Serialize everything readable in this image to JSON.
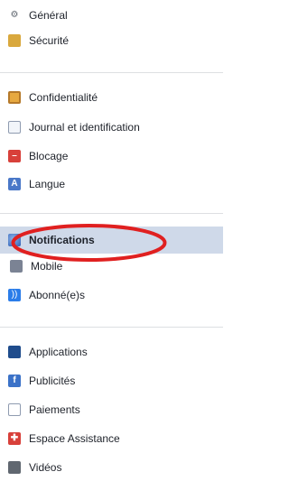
{
  "menu": {
    "items": [
      {
        "label": "Général",
        "icon": "gear-icon"
      },
      {
        "label": "Sécurité",
        "icon": "shield-icon"
      },
      {
        "label": "Confidentialité",
        "icon": "lock-icon"
      },
      {
        "label": "Journal et identification",
        "icon": "journal-icon"
      },
      {
        "label": "Blocage",
        "icon": "block-icon"
      },
      {
        "label": "Langue",
        "icon": "language-icon"
      },
      {
        "label": "Notifications",
        "icon": "globe-icon",
        "active": true
      },
      {
        "label": "Mobile",
        "icon": "mobile-icon"
      },
      {
        "label": "Abonné(e)s",
        "icon": "rss-icon"
      },
      {
        "label": "Applications",
        "icon": "apps-icon"
      },
      {
        "label": "Publicités",
        "icon": "ads-icon"
      },
      {
        "label": "Paiements",
        "icon": "card-icon"
      },
      {
        "label": "Espace Assistance",
        "icon": "help-icon"
      },
      {
        "label": "Vidéos",
        "icon": "video-icon"
      }
    ]
  },
  "colors": {
    "active_background": "#cfd9e9",
    "annotation_ellipse": "#e02020",
    "divider": "#dddfe2"
  }
}
